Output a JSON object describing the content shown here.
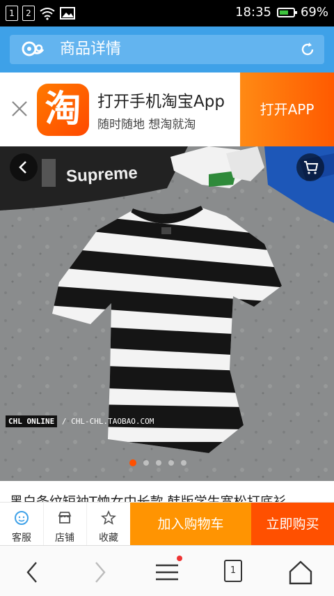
{
  "status_bar": {
    "sim1": "1",
    "sim2": "2",
    "time": "18:35",
    "battery_text": "69%",
    "battery_level": 0.69
  },
  "header": {
    "title": "商品详情"
  },
  "app_banner": {
    "icon_glyph": "淘",
    "title": "打开手机淘宝App",
    "subtitle": "随时随地 想淘就淘",
    "open_button": "打开APP"
  },
  "product_image": {
    "watermark_brand": "CHL ONLINE",
    "watermark_url": "/ CHL-CHL.TAOBAO.COM",
    "skate_text": "Supreme",
    "active_slide": 1,
    "slide_count": 5
  },
  "product": {
    "title": "黑白条纹短袖T恤女中长款 韩版学生宽松打底衫"
  },
  "action_bar": {
    "service": "客服",
    "shop": "店铺",
    "favorite": "收藏",
    "add_to_cart": "加入购物车",
    "buy_now": "立即购买"
  },
  "browser_nav": {
    "tab_count": "1"
  },
  "colors": {
    "header_blue": "#3ea1e8",
    "taobao_orange": "#ff5000",
    "cart_orange": "#ff9402"
  }
}
